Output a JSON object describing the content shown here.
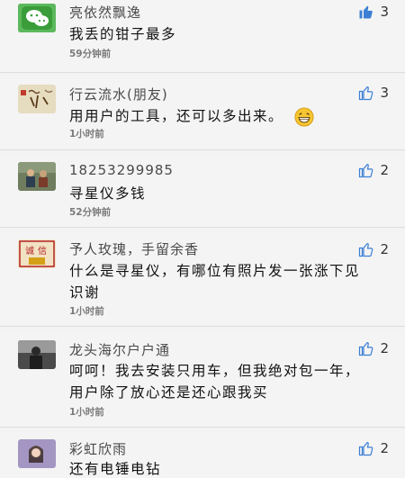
{
  "comments": [
    {
      "name": "亮依然飘逸",
      "text": "我丢的钳子最多",
      "time": "59分钟前",
      "likes": "3",
      "avatar_icon": "wechat-logo-icon",
      "avatar_color": "#3cb034"
    },
    {
      "name": "行云流水(朋友)",
      "text": "用用户的工具，还可以多出来。",
      "time": "1小时前",
      "likes": "3",
      "avatar_icon": "calligraphy-avatar-icon",
      "avatar_color": "#d8c9a2",
      "emoji": "grinning-face-icon"
    },
    {
      "name": "18253299985",
      "text": "寻星仪多钱",
      "time": "52分钟前",
      "likes": "2",
      "avatar_icon": "person-photo-avatar-icon",
      "avatar_color": "#5a6a50"
    },
    {
      "name": "予人玫瑰，手留余香",
      "text": "什么是寻星仪，有哪位有照片发一张涨下见识谢",
      "time": "1小时前",
      "likes": "2",
      "avatar_icon": "red-seal-avatar-icon",
      "avatar_color": "#c0392b"
    },
    {
      "name": "龙头海尔户户通",
      "text": "呵呵！我去安装只用车，但我绝对包一年，用户除了放心还是还心跟我买",
      "time": "1小时前",
      "likes": "2",
      "avatar_icon": "dark-photo-avatar-icon",
      "avatar_color": "#3a3a3a"
    },
    {
      "name": "彩虹欣雨",
      "text": "还有电锤电钻",
      "time": "",
      "likes": "2",
      "avatar_icon": "girl-photo-avatar-icon",
      "avatar_color": "#8a7aa8"
    }
  ],
  "like_icon": "thumbs-up-icon",
  "accent_color": "#4a90d9"
}
